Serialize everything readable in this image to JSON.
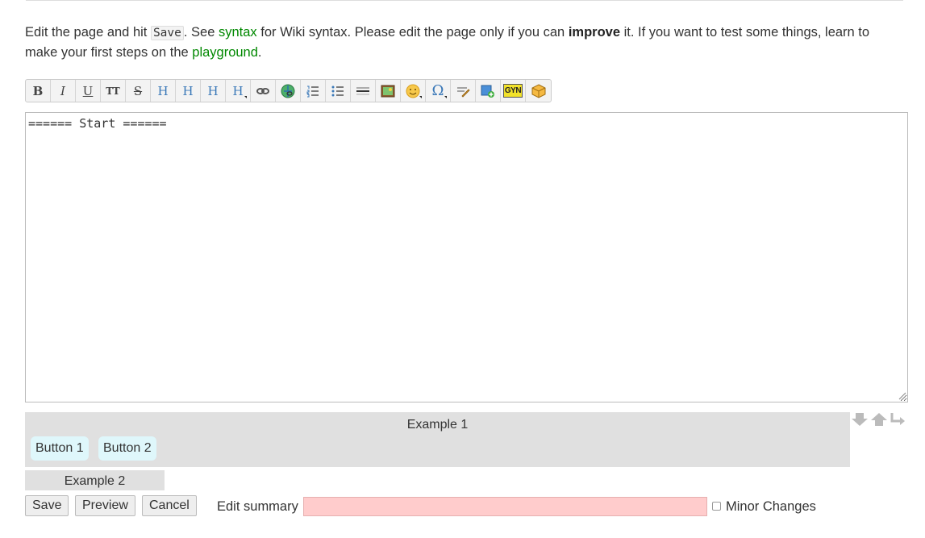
{
  "intro": {
    "t1": "Edit the page and hit ",
    "save_code": "Save",
    "t2": ". See ",
    "syntax_link": "syntax",
    "t3": " for Wiki syntax. Please edit the page only if you can ",
    "improve": "improve",
    "t4": " it. If you want to test some things, learn to make your first steps on the ",
    "playground_link": "playground",
    "t5": "."
  },
  "toolbar": {
    "bold": "B",
    "italic": "I",
    "underline": "U",
    "mono": "TT",
    "strike": "S",
    "h_same": "H",
    "h_lower": "H",
    "h_higher": "H",
    "h_select": "H",
    "gyn": "GYN"
  },
  "editor": {
    "content": "====== Start ======"
  },
  "example1": {
    "title": "Example 1",
    "button1": "Button 1",
    "button2": "Button 2"
  },
  "example2": {
    "title": "Example 2"
  },
  "actions": {
    "save": "Save",
    "preview": "Preview",
    "cancel": "Cancel",
    "summary_label": "Edit summary",
    "summary_value": "",
    "minor_label": "Minor Changes"
  },
  "colors": {
    "link": "#008800",
    "summary_bg": "#ffcccc",
    "example_bg": "#e0e0e0",
    "cyan_button": "#dff7fb"
  }
}
